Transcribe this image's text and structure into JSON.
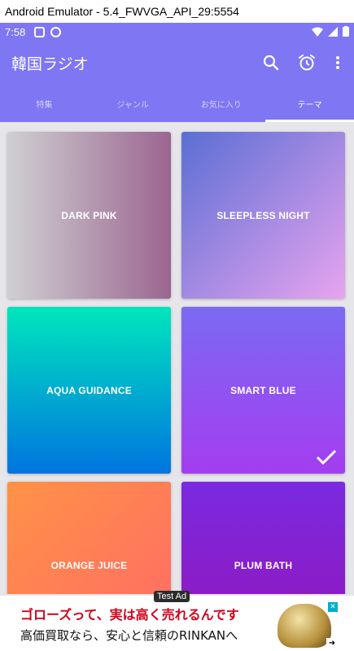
{
  "window": {
    "title": "Android Emulator - 5.4_FWVGA_API_29:5554"
  },
  "status_bar": {
    "time": "7:58"
  },
  "app_bar": {
    "title": "韓国ラジオ",
    "actions": [
      "search-icon",
      "alarm-icon",
      "more-vert-icon"
    ]
  },
  "tabs": [
    {
      "label": "特集",
      "active": false
    },
    {
      "label": "ジャンル",
      "active": false
    },
    {
      "label": "お気に入り",
      "active": false
    },
    {
      "label": "テーマ",
      "active": true
    }
  ],
  "themes": [
    {
      "label": "DARK PINK",
      "gradient": [
        "#cfd0d2",
        "#9b6590"
      ],
      "selected": false
    },
    {
      "label": "SLEEPLESS NIGHT",
      "gradient": [
        "#5b6ed4",
        "#e7a4ef"
      ],
      "selected": false
    },
    {
      "label": "AQUA GUIDANCE",
      "gradient": [
        "#00e6bd",
        "#0074e0"
      ],
      "selected": false
    },
    {
      "label": "SMART BLUE",
      "gradient": [
        "#7b6af2",
        "#a43df0"
      ],
      "selected": true
    },
    {
      "label": "ORANGE JUICE",
      "gradient": [
        "#ff9247",
        "#ff6a66"
      ],
      "selected": false
    },
    {
      "label": "PLUM BATH",
      "gradient": [
        "#7a2ae0",
        "#9216ba"
      ],
      "selected": false
    }
  ],
  "ad": {
    "tag": "Test Ad",
    "line1": "ゴローズって、実は高く売れるんです",
    "line2": "高価買取なら、安心と信頼のRINKANへ",
    "close_symbol": "✕",
    "arrow_symbol": "➜"
  },
  "colors": {
    "primary": "#7f76f4",
    "background": "#e6e6ea",
    "accent_red": "#d0021b"
  }
}
